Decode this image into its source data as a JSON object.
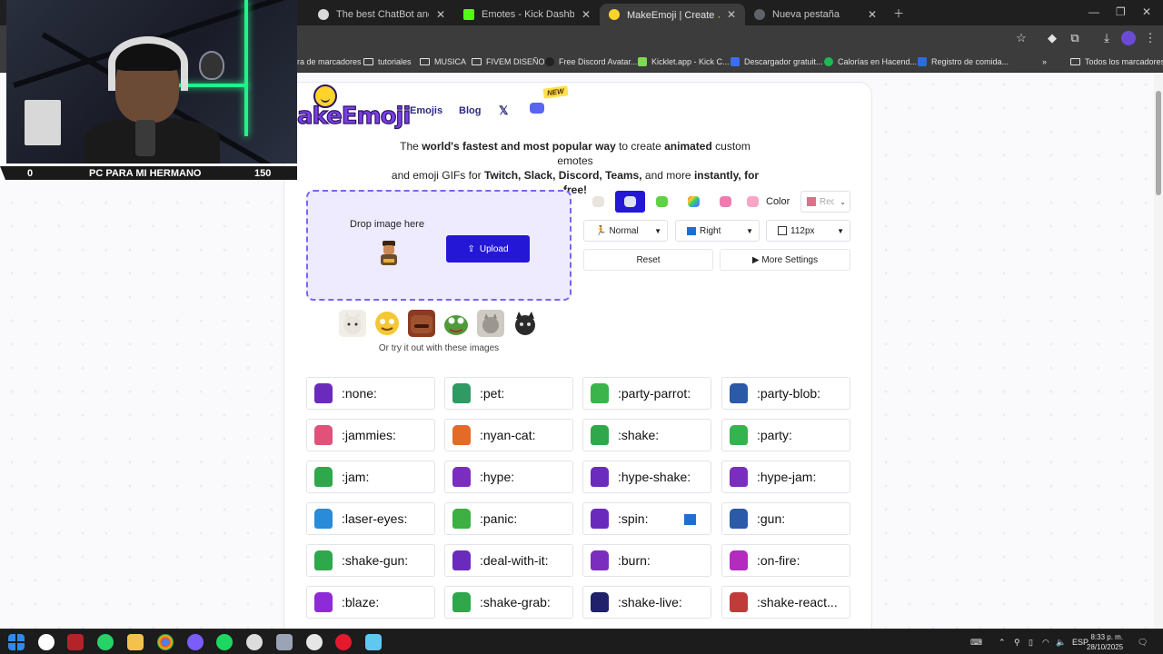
{
  "browser": {
    "tabs": [
      {
        "label": "The best ChatBot and Widgets"
      },
      {
        "label": "Emotes - Kick Dashboard"
      },
      {
        "label": "MakeEmoji | Create ✨animate"
      },
      {
        "label": "Nueva pestaña"
      }
    ],
    "bookmarks": [
      {
        "label": "ra de marcadores"
      },
      {
        "label": "tutoriales"
      },
      {
        "label": "MUSICA"
      },
      {
        "label": "FIVEM DISEÑO"
      },
      {
        "label": "Free Discord Avatar..."
      },
      {
        "label": "Kicklet.app - Kick C..."
      },
      {
        "label": "Descargador gratuit..."
      },
      {
        "label": "Calorías en Hacend..."
      },
      {
        "label": "Registro de comida..."
      }
    ],
    "all_bookmarks": "Todos los marcadores"
  },
  "site": {
    "logo": "akeEmoji",
    "nav": {
      "emojis": "Emojis",
      "blog": "Blog",
      "x": "𝕏",
      "new_badge": "NEW"
    },
    "tagline": {
      "t1": "The ",
      "b1": "world's fastest and most popular way",
      "t2": " to create ",
      "b2": "animated",
      "t3": " custom emotes",
      "t4": "and emoji GIFs for ",
      "b3": "Twitch, Slack, Discord, Teams,",
      "t5": " and more ",
      "b4": "instantly, for free!"
    },
    "dropzone": {
      "text": "Drop image here",
      "upload": "Upload"
    },
    "samples_caption": "Or try it out with these images",
    "settings": {
      "color_label": "Color",
      "color_value": "Red",
      "speed": "Normal",
      "direction": "Right",
      "size": "112px",
      "reset": "Reset",
      "more": "▶ More Settings"
    },
    "effects": [
      ":none:",
      ":pet:",
      ":party-parrot:",
      ":party-blob:",
      ":jammies:",
      ":nyan-cat:",
      ":shake:",
      ":party:",
      ":jam:",
      ":hype:",
      ":hype-shake:",
      ":hype-jam:",
      ":laser-eyes:",
      ":panic:",
      ":spin:",
      ":gun:",
      ":shake-gun:",
      ":deal-with-it:",
      ":burn:",
      ":on-fire:",
      ":blaze:",
      ":shake-grab:",
      ":shake-live:",
      ":shake-react..."
    ]
  },
  "overlay": {
    "goal_current": "0",
    "goal_title": "PC PARA MI HERMANO",
    "goal_target": "150"
  },
  "taskbar": {
    "lang": "ESP",
    "time": "8:33 p. m.",
    "date": "28/10/2025"
  }
}
